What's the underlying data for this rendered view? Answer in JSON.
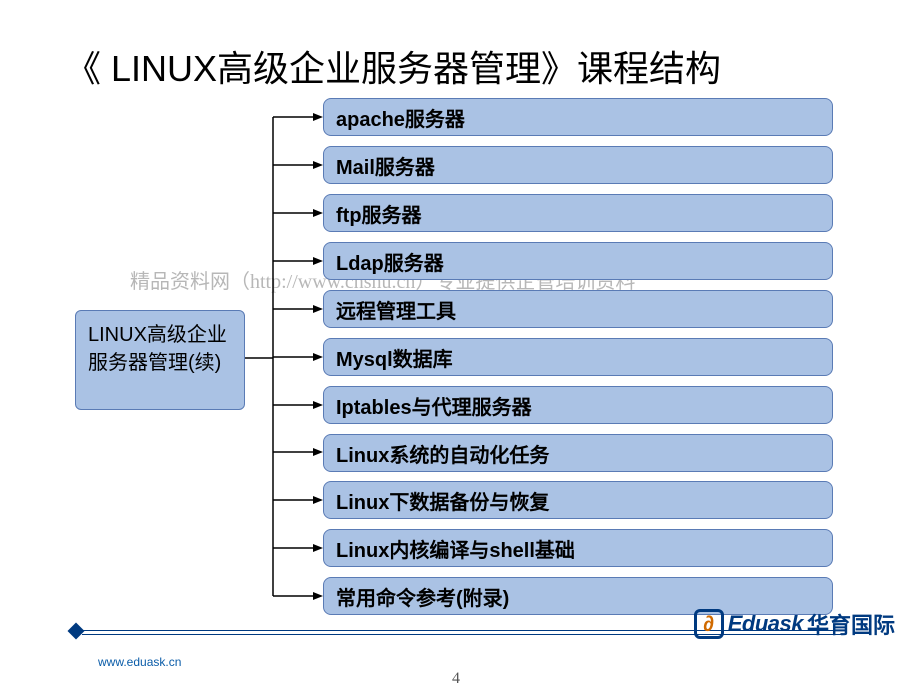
{
  "title": "《 LINUX高级企业服务器管理》课程结构",
  "mainBox": "LINUX高级企业服务器管理(续)",
  "topics": [
    "apache服务器",
    "Mail服务器",
    "ftp服务器",
    "Ldap服务器",
    "远程管理工具",
    "Mysql数据库",
    "Iptables与代理服务器",
    "Linux系统的自动化任务",
    "Linux下数据备份与恢复",
    "Linux内核编译与shell基础",
    "常用命令参考(附录)"
  ],
  "watermark": "精品资料网（http://www.cnshu.cn）专业提供企管培训资料",
  "footer": {
    "url": "www.eduask.cn",
    "page": "4",
    "brandEn": "Eduask",
    "brandCn": "华育国际",
    "brandMark": "∂"
  }
}
